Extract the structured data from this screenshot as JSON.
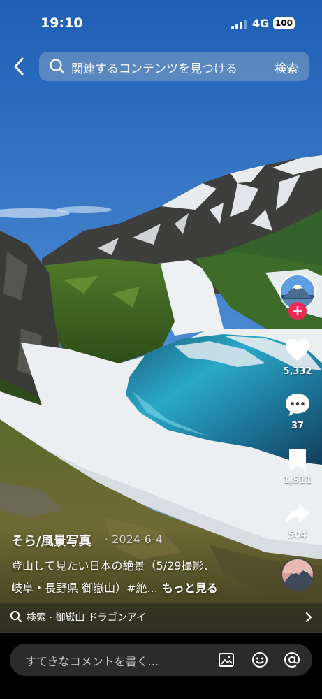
{
  "status_bar": {
    "time": "19:10",
    "network": "4G",
    "battery": "100"
  },
  "search": {
    "placeholder": "関連するコンテンツを見つける",
    "button_label": "検索"
  },
  "actions": {
    "likes": "5,332",
    "comments": "37",
    "saves": "1,511",
    "shares": "504"
  },
  "post": {
    "author": "そら/風景写真",
    "date": "· 2024-6-4",
    "caption_line1": "登山して見たい日本の絶景（5/29撮影、",
    "caption_line2": "岐阜・長野県 御嶽山）#絶...",
    "more_label": "もっと見る"
  },
  "related_search": {
    "text": "検索 · 御嶽山 ドラゴンアイ"
  },
  "comment": {
    "placeholder": "すてきなコメントを書く..."
  },
  "icons": {
    "back": "chevron-left-icon",
    "search": "search-icon",
    "like": "heart-icon",
    "comment": "comment-bubble-icon",
    "save": "bookmark-icon",
    "share": "share-arrow-icon",
    "image": "image-icon",
    "emoji": "emoji-icon",
    "mention": "at-sign-icon"
  },
  "colors": {
    "accent": "#ee2b56",
    "sky": "#2d6fc4",
    "lake": "#2aa9c8"
  }
}
